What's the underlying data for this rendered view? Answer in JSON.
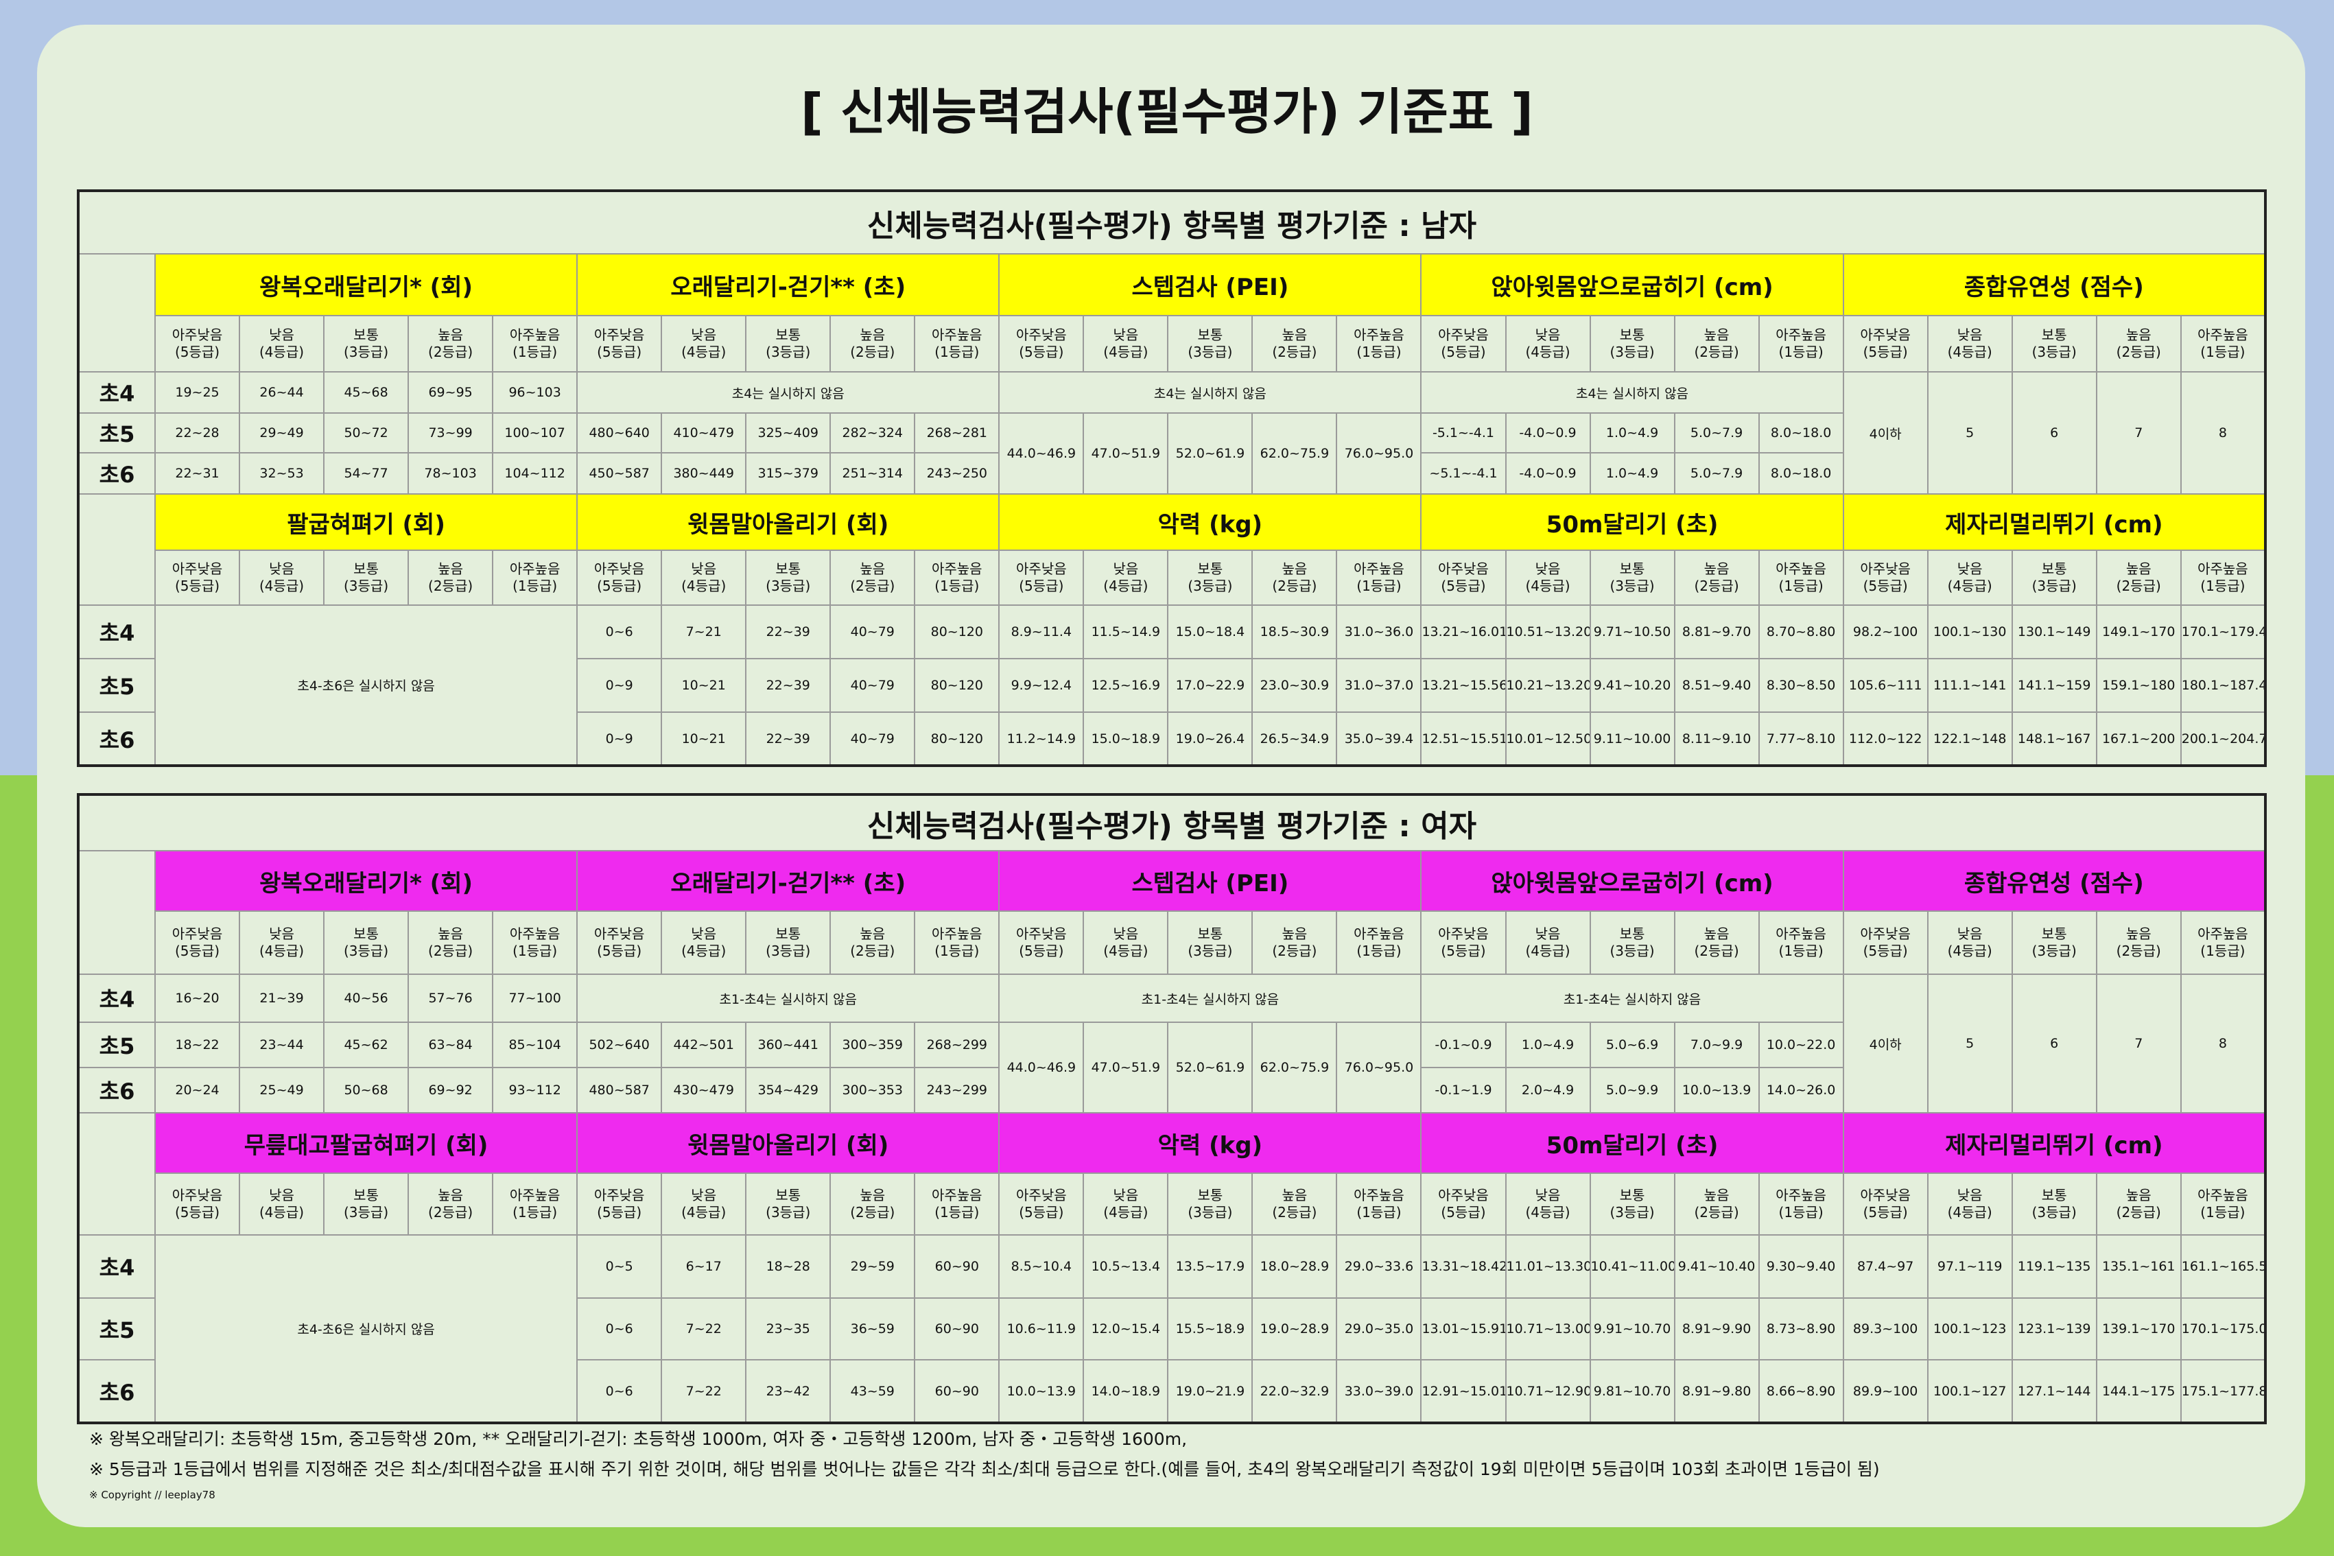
{
  "title": "[ 신체능력검사(필수평가) 기준표 ]",
  "grade_labels": [
    "아주낮음\n(5등급)",
    "낮음\n(4등급)",
    "보통\n(3등급)",
    "높음\n(2등급)",
    "아주높음\n(1등급)"
  ],
  "male": {
    "caption": "신체능력검사(필수평가) 항목별 평가기준 : 남자",
    "rows": [
      "초4",
      "초5",
      "초6"
    ],
    "top_categories": [
      "왕복오래달리기* (회)",
      "오래달리기-걷기** (초)",
      "스텝검사 (PEI)",
      "앉아윗몸앞으로굽히기 (cm)",
      "종합유연성 (점수)"
    ],
    "shuttle": [
      [
        "19~25",
        "26~44",
        "45~68",
        "69~95",
        "96~103"
      ],
      [
        "22~28",
        "29~49",
        "50~72",
        "73~99",
        "100~107"
      ],
      [
        "22~31",
        "32~53",
        "54~77",
        "78~103",
        "104~112"
      ]
    ],
    "run_walk_na": "초4는 실시하지 않음",
    "run_walk": [
      [
        "480~640",
        "410~479",
        "325~409",
        "282~324",
        "268~281"
      ],
      [
        "450~587",
        "380~449",
        "315~379",
        "251~314",
        "243~250"
      ]
    ],
    "step_na": "초4는 실시하지 않음",
    "step": [
      "44.0~46.9",
      "47.0~51.9",
      "52.0~61.9",
      "62.0~75.9",
      "76.0~95.0"
    ],
    "sitreach_na": "초4는 실시하지 않음",
    "sitreach": [
      [
        "-5.1~-4.1",
        "-4.0~0.9",
        "1.0~4.9",
        "5.0~7.9",
        "8.0~18.0"
      ],
      [
        "~5.1~-4.1",
        "-4.0~0.9",
        "1.0~4.9",
        "5.0~7.9",
        "8.0~18.0"
      ]
    ],
    "flex": [
      "4이하",
      "5",
      "6",
      "7",
      "8"
    ],
    "bottom_categories": [
      "팔굽혀펴기 (회)",
      "윗몸말아올리기 (회)",
      "악력 (kg)",
      "50m달리기 (초)",
      "제자리멀리뛰기 (cm)"
    ],
    "pushup_na": "초4-초6은 실시하지 않음",
    "curlup": [
      [
        "0~6",
        "7~21",
        "22~39",
        "40~79",
        "80~120"
      ],
      [
        "0~9",
        "10~21",
        "22~39",
        "40~79",
        "80~120"
      ],
      [
        "0~9",
        "10~21",
        "22~39",
        "40~79",
        "80~120"
      ]
    ],
    "grip": [
      [
        "8.9~11.4",
        "11.5~14.9",
        "15.0~18.4",
        "18.5~30.9",
        "31.0~36.0"
      ],
      [
        "9.9~12.4",
        "12.5~16.9",
        "17.0~22.9",
        "23.0~30.9",
        "31.0~37.0"
      ],
      [
        "11.2~14.9",
        "15.0~18.9",
        "19.0~26.4",
        "26.5~34.9",
        "35.0~39.4"
      ]
    ],
    "dash": [
      [
        "13.21~16.01",
        "10.51~13.20",
        "9.71~10.50",
        "8.81~9.70",
        "8.70~8.80"
      ],
      [
        "13.21~15.56",
        "10.21~13.20",
        "9.41~10.20",
        "8.51~9.40",
        "8.30~8.50"
      ],
      [
        "12.51~15.51",
        "10.01~12.50",
        "9.11~10.00",
        "8.11~9.10",
        "7.77~8.10"
      ]
    ],
    "jump": [
      [
        "98.2~100",
        "100.1~130",
        "130.1~149",
        "149.1~170",
        "170.1~179.4"
      ],
      [
        "105.6~111",
        "111.1~141",
        "141.1~159",
        "159.1~180",
        "180.1~187.4"
      ],
      [
        "112.0~122",
        "122.1~148",
        "148.1~167",
        "167.1~200",
        "200.1~204.7"
      ]
    ]
  },
  "female": {
    "caption": "신체능력검사(필수평가) 항목별 평가기준 : 여자",
    "rows": [
      "초4",
      "초5",
      "초6"
    ],
    "top_categories": [
      "왕복오래달리기* (회)",
      "오래달리기-걷기** (초)",
      "스텝검사 (PEI)",
      "앉아윗몸앞으로굽히기 (cm)",
      "종합유연성 (점수)"
    ],
    "shuttle": [
      [
        "16~20",
        "21~39",
        "40~56",
        "57~76",
        "77~100"
      ],
      [
        "18~22",
        "23~44",
        "45~62",
        "63~84",
        "85~104"
      ],
      [
        "20~24",
        "25~49",
        "50~68",
        "69~92",
        "93~112"
      ]
    ],
    "run_walk_na": "초1-초4는 실시하지 않음",
    "run_walk": [
      [
        "502~640",
        "442~501",
        "360~441",
        "300~359",
        "268~299"
      ],
      [
        "480~587",
        "430~479",
        "354~429",
        "300~353",
        "243~299"
      ]
    ],
    "step_na": "초1-초4는 실시하지 않음",
    "step": [
      "44.0~46.9",
      "47.0~51.9",
      "52.0~61.9",
      "62.0~75.9",
      "76.0~95.0"
    ],
    "sitreach_na": "초1-초4는 실시하지 않음",
    "sitreach": [
      [
        "-0.1~0.9",
        "1.0~4.9",
        "5.0~6.9",
        "7.0~9.9",
        "10.0~22.0"
      ],
      [
        "-0.1~1.9",
        "2.0~4.9",
        "5.0~9.9",
        "10.0~13.9",
        "14.0~26.0"
      ]
    ],
    "flex": [
      "4이하",
      "5",
      "6",
      "7",
      "8"
    ],
    "bottom_categories": [
      "무릎대고팔굽혀펴기 (회)",
      "윗몸말아올리기 (회)",
      "악력 (kg)",
      "50m달리기 (초)",
      "제자리멀리뛰기 (cm)"
    ],
    "pushup_na": "초4-초6은 실시하지 않음",
    "curlup": [
      [
        "0~5",
        "6~17",
        "18~28",
        "29~59",
        "60~90"
      ],
      [
        "0~6",
        "7~22",
        "23~35",
        "36~59",
        "60~90"
      ],
      [
        "0~6",
        "7~22",
        "23~42",
        "43~59",
        "60~90"
      ]
    ],
    "grip": [
      [
        "8.5~10.4",
        "10.5~13.4",
        "13.5~17.9",
        "18.0~28.9",
        "29.0~33.6"
      ],
      [
        "10.6~11.9",
        "12.0~15.4",
        "15.5~18.9",
        "19.0~28.9",
        "29.0~35.0"
      ],
      [
        "10.0~13.9",
        "14.0~18.9",
        "19.0~21.9",
        "22.0~32.9",
        "33.0~39.0"
      ]
    ],
    "dash": [
      [
        "13.31~18.42",
        "11.01~13.30",
        "10.41~11.00",
        "9.41~10.40",
        "9.30~9.40"
      ],
      [
        "13.01~15.91",
        "10.71~13.00",
        "9.91~10.70",
        "8.91~9.90",
        "8.73~8.90"
      ],
      [
        "12.91~15.01",
        "10.71~12.90",
        "9.81~10.70",
        "8.91~9.80",
        "8.66~8.90"
      ]
    ],
    "jump": [
      [
        "87.4~97",
        "97.1~119",
        "119.1~135",
        "135.1~161",
        "161.1~165.5"
      ],
      [
        "89.3~100",
        "100.1~123",
        "123.1~139",
        "139.1~170",
        "170.1~175.0"
      ],
      [
        "89.9~100",
        "100.1~127",
        "127.1~144",
        "144.1~175",
        "175.1~177.8"
      ]
    ]
  },
  "notes": {
    "note1": "※  왕복오래달리기: 초등학생 15m, 중고등학생 20m, ** 오래달리기-걷기: 초등학생 1000m, 여자 중・고등학생 1200m, 남자 중・고등학생 1600m,",
    "note2": "※ 5등급과 1등급에서 범위를 지정해준 것은 최소/최대점수값을 표시해 주기 위한 것이며, 해당 범위를 벗어나는 값들은 각각 최소/최대 등급으로 한다.(예를 들어, 초4의 왕복오래달리기 측정값이 19회 미만이면 5등급이며 103회 초과이면 1등급이 됨)",
    "copyright": "※   Copyright // leeplay78"
  }
}
